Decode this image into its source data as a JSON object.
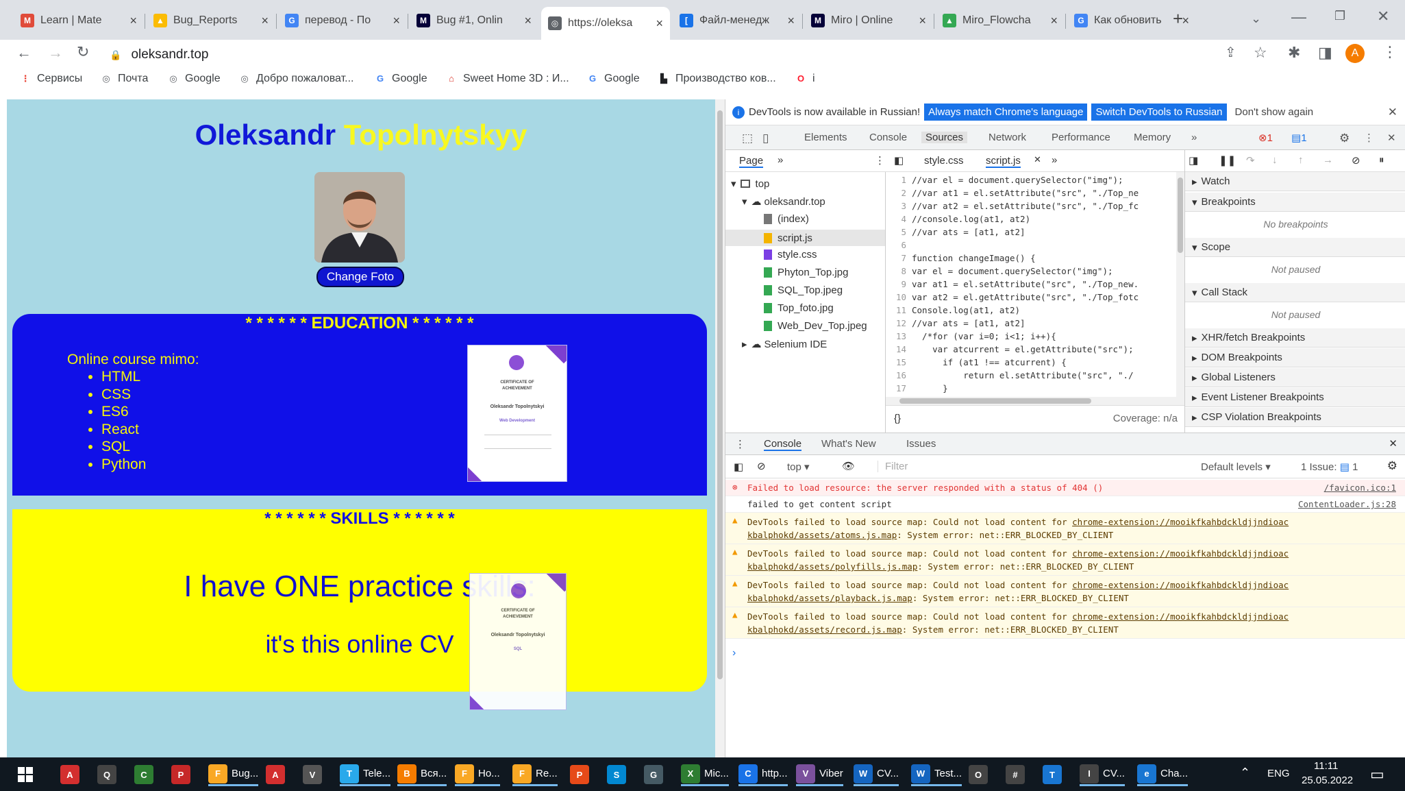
{
  "tabs": [
    {
      "title": "Learn | Mate",
      "fav": "Mate",
      "color": "#e04b3a"
    },
    {
      "title": "Bug_Reports",
      "fav": "drive",
      "color": "#fbbc04"
    },
    {
      "title": "перевод - По",
      "fav": "G",
      "color": "#4285f4"
    },
    {
      "title": "Bug #1, Onlin",
      "fav": "M",
      "color": "#050038"
    },
    {
      "title": "https://oleksa",
      "fav": "globe",
      "color": "#5f6368",
      "active": true
    },
    {
      "title": "Файл-менедж",
      "fav": "[]",
      "color": "#1a73e8"
    },
    {
      "title": "Miro | Online",
      "fav": "M",
      "color": "#050038"
    },
    {
      "title": "Miro_Flowcha",
      "fav": "drive",
      "color": "#34a853"
    },
    {
      "title": "Как обновить",
      "fav": "G",
      "color": "#4285f4"
    }
  ],
  "toolbar": {
    "url": "oleksandr.top",
    "profile_initial": "A",
    "new_tab": "+"
  },
  "bookmarks": [
    {
      "label": "Сервисы",
      "icon": "apps-icon",
      "color": "#ea4335"
    },
    {
      "label": "Почта",
      "icon": "globe-icon",
      "color": "#5f6368"
    },
    {
      "label": "Google",
      "icon": "globe-icon",
      "color": "#5f6368"
    },
    {
      "label": "Добро пожаловат...",
      "icon": "globe-icon",
      "color": "#5f6368"
    },
    {
      "label": "Google",
      "icon": "google-icon",
      "color": "#4285f4"
    },
    {
      "label": "Sweet Home 3D : И...",
      "icon": "home-icon",
      "color": "#d93025"
    },
    {
      "label": "Google",
      "icon": "google-icon",
      "color": "#4285f4"
    },
    {
      "label": "Производство ков...",
      "icon": "factory-icon",
      "color": "#202124"
    },
    {
      "label": "i",
      "icon": "opera-icon",
      "color": "#ff1b2d"
    }
  ],
  "page": {
    "first_name": "Oleksandr",
    "last_name": "Topolnytskyy",
    "change_photo": "Change Foto",
    "education_heading": "* * * * * * EDUCATION * * * * * *",
    "education_lead": "Online course mimo:",
    "education_items": [
      "HTML",
      "CSS",
      "ES6",
      "React",
      "SQL",
      "Python"
    ],
    "certificate_title": "CERTIFICATE OF ACHIEVEMENT",
    "certificate_name": "Oleksandr Topolnytskyi",
    "certificate_course": "Web Development",
    "certificate2_course": "SQL",
    "skills_heading": "* * * * * * SKILLS * * * * * *",
    "skills_line1": "I have ONE practice skills:",
    "skills_line2": "it's this online CV"
  },
  "devtools": {
    "info_text": "DevTools is now available in Russian!",
    "btn_match": "Always match Chrome's language",
    "btn_switch": "Switch DevTools to Russian",
    "btn_dont": "Don't show again",
    "tabs": [
      "Elements",
      "Console",
      "Sources",
      "Network",
      "Performance",
      "Memory"
    ],
    "selected_tab": "Sources",
    "error_count": "1",
    "message_count": "1",
    "navigator_tab": "Page",
    "file_tabs": [
      "style.css",
      "script.js"
    ],
    "tree": [
      {
        "label": "top",
        "depth": 0
      },
      {
        "label": "oleksandr.top",
        "depth": 1
      },
      {
        "label": "(index)",
        "depth": 2,
        "color": "#777"
      },
      {
        "label": "script.js",
        "depth": 2,
        "color": "#f4b400",
        "selected": true
      },
      {
        "label": "style.css",
        "depth": 2,
        "color": "#7b3fe4"
      },
      {
        "label": "Phyton_Top.jpg",
        "depth": 2,
        "color": "#34a853"
      },
      {
        "label": "SQL_Top.jpeg",
        "depth": 2,
        "color": "#34a853"
      },
      {
        "label": "Top_foto.jpg",
        "depth": 2,
        "color": "#34a853"
      },
      {
        "label": "Web_Dev_Top.jpeg",
        "depth": 2,
        "color": "#34a853"
      },
      {
        "label": "Selenium IDE",
        "depth": 1
      }
    ],
    "code": [
      "//var el = document.querySelector(\"img\");",
      "//var at1 = el.setAttribute(\"src\", \"./Top_ne",
      "//var at2 = el.setAttribute(\"src\", \"./Top_fc",
      "//console.log(at1, at2)",
      "//var ats = [at1, at2]",
      "",
      "function changeImage() {",
      "var el = document.querySelector(\"img\");",
      "var at1 = el.setAttribute(\"src\", \"./Top_new.",
      "var at2 = el.getAttribute(\"src\", \"./Top_fotc",
      "Console.log(at1, at2)",
      "//var ats = [at1, at2]",
      "  /*for (var i=0; i<1; i++){",
      "    var atcurrent = el.getAttribute(\"src\");",
      "      if (at1 !== atcurrent) {",
      "          return el.setAttribute(\"src\", \"./",
      "      }"
    ],
    "coverage": "Coverage: n/a",
    "debugger": {
      "watch": "Watch",
      "breakpoints": "Breakpoints",
      "no_breakpoints": "No breakpoints",
      "scope": "Scope",
      "not_paused": "Not paused",
      "call_stack": "Call Stack",
      "sections": [
        "XHR/fetch Breakpoints",
        "DOM Breakpoints",
        "Global Listeners",
        "Event Listener Breakpoints",
        "CSP Violation Breakpoints"
      ]
    },
    "drawer_tabs": [
      "Console",
      "What's New",
      "Issues"
    ],
    "console_context": "top",
    "filter_placeholder": "Filter",
    "default_levels": "Default levels",
    "issues_label": "1 Issue:",
    "issues_count": "1",
    "messages": [
      {
        "type": "error",
        "text": "Failed to load resource: the server responded with a status of 404 ()",
        "src": "/favicon.ico:1"
      },
      {
        "type": "info",
        "text": "failed to get content script",
        "src": "ContentLoader.js:28"
      },
      {
        "type": "warn",
        "pre": "DevTools failed to load source map: Could not load content for ",
        "link": "chrome-extension://mooikfkahbdckldjjndioac kbalphokd/assets/atoms.js.map",
        "post": ": System error: net::ERR_BLOCKED_BY_CLIENT"
      },
      {
        "type": "warn",
        "pre": "DevTools failed to load source map: Could not load content for ",
        "link": "chrome-extension://mooikfkahbdckldjjndioac kbalphokd/assets/polyfills.js.map",
        "post": ": System error: net::ERR_BLOCKED_BY_CLIENT"
      },
      {
        "type": "warn",
        "pre": "DevTools failed to load source map: Could not load content for ",
        "link": "chrome-extension://mooikfkahbdckldjjndioac kbalphokd/assets/playback.js.map",
        "post": ": System error: net::ERR_BLOCKED_BY_CLIENT"
      },
      {
        "type": "warn",
        "pre": "DevTools failed to load source map: Could not load content for ",
        "link": "chrome-extension://mooikfkahbdckldjjndioac kbalphokd/assets/record.js.map",
        "post": ": System error: net::ERR_BLOCKED_BY_CLIENT"
      }
    ]
  },
  "taskbar": {
    "items": [
      {
        "label": "",
        "color": "#d32f2f",
        "glyph": "A"
      },
      {
        "label": "",
        "color": "#444",
        "glyph": "Q"
      },
      {
        "label": "",
        "color": "#2e7d32",
        "glyph": "C"
      },
      {
        "label": "",
        "color": "#c62828",
        "glyph": "P"
      },
      {
        "label": "Bug...",
        "color": "#f9a825",
        "glyph": "F"
      },
      {
        "label": "",
        "color": "#d32f2f",
        "glyph": "A"
      },
      {
        "label": "",
        "color": "#555",
        "glyph": "V"
      },
      {
        "label": "Tele...",
        "color": "#29a9eb",
        "glyph": "T"
      },
      {
        "label": "Вся...",
        "color": "#f57c00",
        "glyph": "В"
      },
      {
        "label": "Ho...",
        "color": "#f9a825",
        "glyph": "F"
      },
      {
        "label": "Re...",
        "color": "#f9a825",
        "glyph": "F"
      },
      {
        "label": "",
        "color": "#e64a19",
        "glyph": "P"
      },
      {
        "label": "",
        "color": "#0288d1",
        "glyph": "S"
      },
      {
        "label": "",
        "color": "#455a64",
        "glyph": "G"
      },
      {
        "label": "Mic...",
        "color": "#2e7d32",
        "glyph": "X"
      },
      {
        "label": "http...",
        "color": "#1a73e8",
        "glyph": "C"
      },
      {
        "label": "Viber",
        "color": "#7b519d",
        "glyph": "V"
      },
      {
        "label": "CV...",
        "color": "#1565c0",
        "glyph": "W"
      },
      {
        "label": "Test...",
        "color": "#1565c0",
        "glyph": "W"
      },
      {
        "label": "",
        "color": "#444",
        "glyph": "O"
      },
      {
        "label": "",
        "color": "#444",
        "glyph": "#"
      },
      {
        "label": "",
        "color": "#1976d2",
        "glyph": "T"
      },
      {
        "label": "CV...",
        "color": "#444",
        "glyph": "I"
      },
      {
        "label": "Cha...",
        "color": "#1976d2",
        "glyph": "e"
      }
    ],
    "lang": "ENG",
    "time": "11:11",
    "date": "25.05.2022"
  }
}
